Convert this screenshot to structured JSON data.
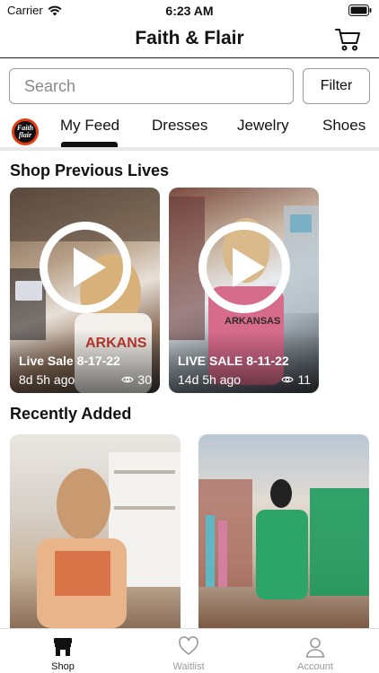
{
  "status_bar": {
    "carrier": "Carrier",
    "time": "6:23 AM"
  },
  "header": {
    "title": "Faith & Flair",
    "cart_icon": "cart-icon"
  },
  "search": {
    "placeholder": "Search",
    "value": ""
  },
  "filter": {
    "label": "Filter"
  },
  "tabs": [
    {
      "label": "My Feed",
      "active": true
    },
    {
      "label": "Dresses",
      "active": false
    },
    {
      "label": "Jewelry",
      "active": false
    },
    {
      "label": "Shoes",
      "active": false
    }
  ],
  "store_logo": {
    "text": "Faith flair"
  },
  "previous_lives": {
    "title": "Shop Previous Lives",
    "items": [
      {
        "title": "Live Sale 8-17-22",
        "ago": "8d 5h ago",
        "views": "30"
      },
      {
        "title": "LIVE SALE 8-11-22",
        "ago": "14d 5h ago",
        "views": "11"
      }
    ]
  },
  "recently_added": {
    "title": "Recently Added"
  },
  "tab_bar": [
    {
      "label": "Shop",
      "icon": "shop-icon",
      "active": true
    },
    {
      "label": "Waitlist",
      "icon": "heart-icon",
      "active": false
    },
    {
      "label": "Account",
      "icon": "person-icon",
      "active": false
    }
  ],
  "colors": {
    "accent": "#111111",
    "logo_ring": "#e23b10",
    "inactive": "#999999"
  }
}
